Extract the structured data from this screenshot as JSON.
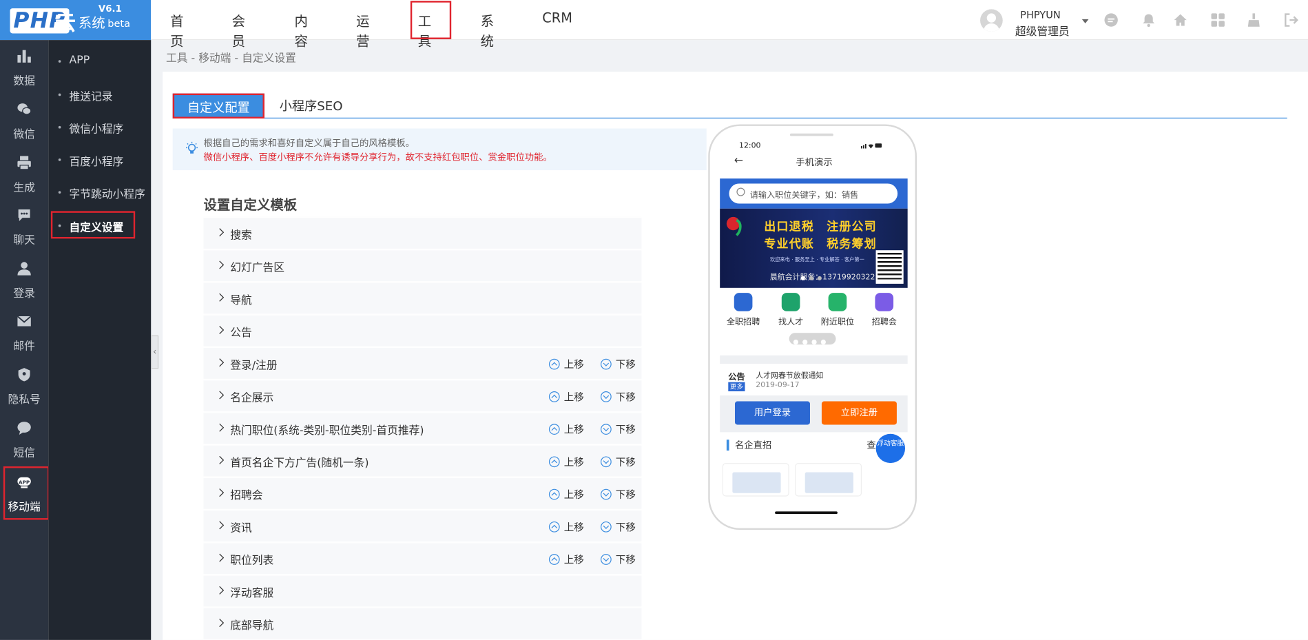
{
  "logo": {
    "brand": "PHP",
    "cloud": "云",
    "system": "系统",
    "version": "V6.1",
    "beta": "beta"
  },
  "topnav": {
    "items": [
      {
        "label": "首页"
      },
      {
        "label": "会员"
      },
      {
        "label": "内容"
      },
      {
        "label": "运营"
      },
      {
        "label": "工具"
      },
      {
        "label": "系统"
      },
      {
        "label": "CRM"
      }
    ],
    "active": "工具"
  },
  "user": {
    "name": "PHPYUN",
    "role": "超级管理员"
  },
  "header_icons": [
    "chat-icon",
    "bell-icon",
    "home-icon",
    "grid-icon",
    "broom-icon",
    "logout-icon"
  ],
  "leftbar": {
    "items": [
      {
        "label": "数据",
        "icon": "bar-chart-icon"
      },
      {
        "label": "微信",
        "icon": "wechat-icon"
      },
      {
        "label": "生成",
        "icon": "print-icon"
      },
      {
        "label": "聊天",
        "icon": "chat-bubble-icon"
      },
      {
        "label": "登录",
        "icon": "user-icon"
      },
      {
        "label": "邮件",
        "icon": "mail-icon"
      },
      {
        "label": "隐私号",
        "icon": "shield-icon"
      },
      {
        "label": "短信",
        "icon": "message-icon"
      },
      {
        "label": "移动端",
        "icon": "app-icon",
        "badge": "APP"
      }
    ],
    "active": "移动端"
  },
  "submenu": {
    "items": [
      {
        "label": "APP"
      },
      {
        "label": "推送记录"
      },
      {
        "label": "微信小程序"
      },
      {
        "label": "百度小程序"
      },
      {
        "label": "字节跳动小程序"
      },
      {
        "label": "自定义设置"
      }
    ],
    "active": "自定义设置"
  },
  "breadcrumb": "工具 - 移动端 - 自定义设置",
  "tabs": [
    {
      "label": "自定义配置"
    },
    {
      "label": "小程序SEO"
    }
  ],
  "notice": {
    "line1": "根据自己的需求和喜好自定义属于自己的风格模板。",
    "line2": "微信小程序、百度小程序不允许有诱导分享行为，故不支持红包职位、赏金职位功能。"
  },
  "section_title": "设置自定义模板",
  "move_up": "上移",
  "move_down": "下移",
  "modules": [
    {
      "label": "搜索",
      "movable": false
    },
    {
      "label": "幻灯广告区",
      "movable": false
    },
    {
      "label": "导航",
      "movable": false
    },
    {
      "label": "公告",
      "movable": false
    },
    {
      "label": "登录/注册",
      "movable": true
    },
    {
      "label": "名企展示",
      "movable": true
    },
    {
      "label": "热门职位(系统-类别-职位类别-首页推荐)",
      "movable": true
    },
    {
      "label": "首页名企下方广告(随机一条)",
      "movable": true
    },
    {
      "label": "招聘会",
      "movable": true
    },
    {
      "label": "资讯",
      "movable": true
    },
    {
      "label": "职位列表",
      "movable": true
    },
    {
      "label": "浮动客服",
      "movable": false
    },
    {
      "label": "底部导航",
      "movable": false
    }
  ],
  "phone": {
    "time": "12:00",
    "title": "手机演示",
    "back": "←",
    "search_placeholder": "请输入职位关键字，如：销售",
    "banner": {
      "line1": "出口退税　注册公司",
      "line2": "专业代账　税务筹划",
      "line3": "欢迎来电 · 服务至上 · 专业解答 · 客户第一",
      "phone_line": "晨航会计服务：13719920322"
    },
    "nav": [
      {
        "label": "全职招聘",
        "color": "#2c68d2"
      },
      {
        "label": "找人才",
        "color": "#1ea36b"
      },
      {
        "label": "附近职位",
        "color": "#26b36a"
      },
      {
        "label": "招聘会",
        "color": "#7b5ce6"
      }
    ],
    "notice_label": "公告",
    "notice_more": "更多",
    "notice_title": "人才网春节放假通知",
    "notice_date": "2019-09-17",
    "login_btn": "用户登录",
    "register_btn": "立即注册",
    "login_color": "#2c68d2",
    "register_color": "#ff6a00",
    "ent_title": "名企直招",
    "ent_more": "查",
    "float_cs": "浮动客服"
  },
  "colors": {
    "brand": "#3b8de0",
    "highlight_box": "#e0242e",
    "sidebar": "#2b3340",
    "submenu": "#212730"
  }
}
